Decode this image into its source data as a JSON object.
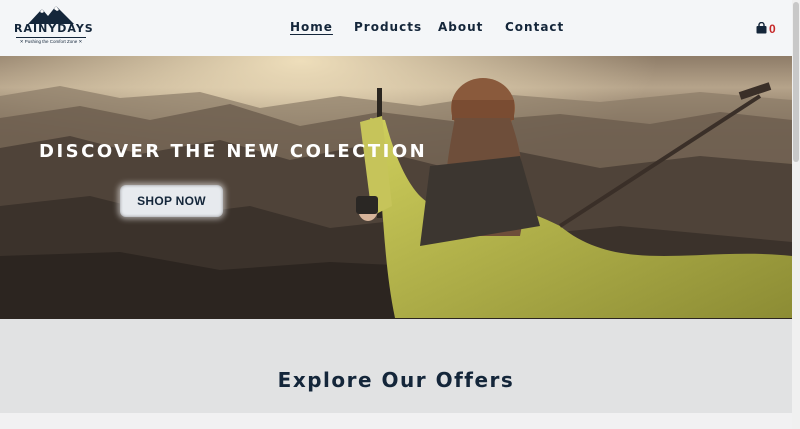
{
  "brand": {
    "name": "RAINYDAYS",
    "tagline": "✕ Pushing the Comfort Zone ✕"
  },
  "nav": {
    "items": [
      {
        "label": "Home",
        "active": true
      },
      {
        "label": "Products",
        "active": false
      },
      {
        "label": "About",
        "active": false
      },
      {
        "label": "Contact",
        "active": false
      }
    ]
  },
  "cart": {
    "icon": "shopping-bag-icon",
    "count": "0"
  },
  "hero": {
    "title": "DISCOVER THE NEW COLECTION",
    "button_label": "SHOP NOW"
  },
  "explore": {
    "title": "Explore Our Offers"
  },
  "colors": {
    "brand_navy": "#14263a",
    "cart_count": "#c62828",
    "hammock": "#b7b54a"
  }
}
